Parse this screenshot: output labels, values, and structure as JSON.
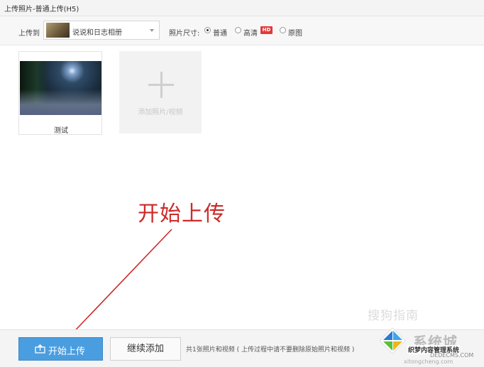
{
  "window": {
    "title": "上传照片-普通上传(H5)"
  },
  "toolbar": {
    "upload_to_label": "上传到",
    "album_name": "说说和日志相册",
    "size_label": "照片尺寸:",
    "size_options": [
      {
        "label": "普通",
        "selected": true
      },
      {
        "label": "高清",
        "selected": false,
        "badge": "HD"
      },
      {
        "label": "原图",
        "selected": false
      }
    ]
  },
  "photos": [
    {
      "caption": "测试"
    }
  ],
  "add_tile": {
    "label": "添加照片/视频"
  },
  "annotation": {
    "text": "开始上传",
    "color": "#cc2a2a"
  },
  "bottom": {
    "start_label": "开始上传",
    "continue_label": "继续添加",
    "info": "共1张照片和视频 ( 上传过程中请不要删除原始照片和视频 )"
  },
  "watermarks": {
    "sogou": "搜狗指南",
    "brand": "系统城",
    "site_name": "织梦内容管理系统",
    "dede": "DEDECMS.COM",
    "domain": "xitongcheng.com"
  },
  "colors": {
    "primary_button": "#4a9ee0",
    "hd_badge": "#e03a3a"
  }
}
